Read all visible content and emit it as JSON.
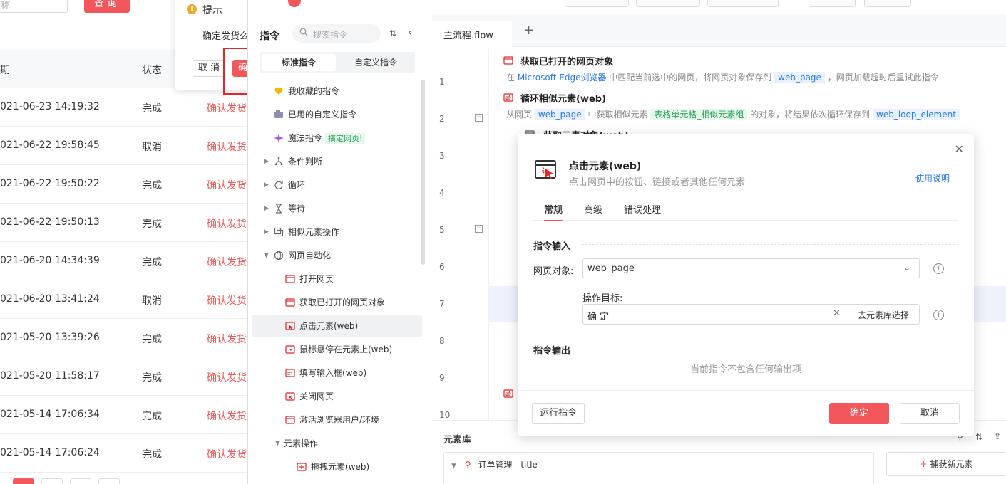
{
  "background_page": {
    "search_placeholder": "称",
    "query_button": "查询",
    "table_headers": {
      "date": "期",
      "status": "状态"
    },
    "rows": [
      {
        "date": "021-06-23 14:19:32",
        "status": "完成",
        "action": "确认发货"
      },
      {
        "date": "021-06-22 19:58:45",
        "status": "取消",
        "action": "确认发货"
      },
      {
        "date": "021-06-22 19:50:22",
        "status": "完成",
        "action": "确认发货"
      },
      {
        "date": "021-06-22 19:50:13",
        "status": "完成",
        "action": "确认发货"
      },
      {
        "date": "021-06-20 14:34:39",
        "status": "完成",
        "action": "确认发货"
      },
      {
        "date": "021-06-20 13:41:24",
        "status": "取消",
        "action": "确认发货"
      },
      {
        "date": "021-05-20 13:39:26",
        "status": "完成",
        "action": "确认发货"
      },
      {
        "date": "021-05-20 11:58:17",
        "status": "完成",
        "action": "确认发货"
      },
      {
        "date": "021-05-14 17:06:34",
        "status": "完成",
        "action": "确认发货"
      },
      {
        "date": "021-05-14 17:06:24",
        "status": "完成",
        "action": "确认发货"
      }
    ],
    "popup": {
      "title": "提示",
      "message": "确定发货么",
      "cancel": "取 消",
      "ok": "确"
    }
  },
  "instructions_panel": {
    "title": "指令",
    "search_placeholder": "搜索指令",
    "tabs": [
      "标准指令",
      "自定义指令"
    ],
    "items": {
      "favorites": "我收藏的指令",
      "used_custom": "已用的自定义指令",
      "magic": "魔法指令",
      "magic_tag": "搞定网页!",
      "condition": "条件判断",
      "loop": "循环",
      "wait": "等待",
      "similar": "相似元素操作",
      "web_auto": "网页自动化",
      "open_page": "打开网页",
      "get_page": "获取已打开的网页对象",
      "click_element": "点击元素(web)",
      "hover": "鼠标悬停在元素上(web)",
      "fill_input": "填写输入框(web)",
      "close_page": "关闭网页",
      "activate_browser": "激活浏览器用户/环境",
      "elem_ops": "元素操作",
      "drag": "拖拽元素(web)"
    }
  },
  "editor": {
    "tab_name": "主流程.flow",
    "line_numbers": [
      "1",
      "2",
      "3",
      "4",
      "5",
      "6",
      "7",
      "8",
      "9",
      "10"
    ],
    "stmt1": {
      "title": "获取已打开的网页对象",
      "d1": "在",
      "browser": "Microsoft Edge浏览器",
      "d2": "中匹配当前选中的网页，将网页对象保存到",
      "var": "web_page",
      "d3": "，网页加载超时后重试此指令"
    },
    "stmt2": {
      "title": "循环相似元素(web)",
      "d1": "从网页",
      "var1": "web_page",
      "d2": "中获取相似元素",
      "elem": "表格单元格_相似元素组",
      "d3": "的对象，将结果依次循环保存到",
      "var2": "web_loop_element"
    },
    "stmt3_partial": "获取元素对象(web)"
  },
  "element_library": {
    "title": "元素库",
    "root_item": "订单管理 - title",
    "capture_button": "捕获新元素"
  },
  "dialog": {
    "title": "点击元素(web)",
    "subtitle": "点击网页中的按钮、链接或者其他任何元素",
    "help_link": "使用说明",
    "tabs": [
      "常规",
      "高级",
      "错误处理"
    ],
    "input_section": "指令输入",
    "web_page_label": "网页对象:",
    "web_page_value": "web_page",
    "target_label": "操作目标:",
    "target_value": "确 定",
    "pick_from_library": "去元素库选择",
    "output_section": "指令输出",
    "no_output": "当前指令不包含任何输出项",
    "run_button": "运行指令",
    "ok_button": "确定",
    "cancel_button": "取消"
  }
}
